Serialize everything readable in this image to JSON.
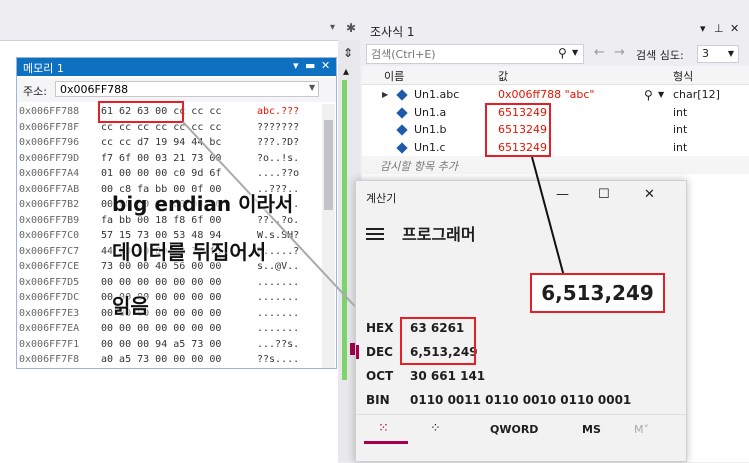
{
  "memory": {
    "title": "메모리 1",
    "address_label": "주소:",
    "address_value": "0x006FF788",
    "rows": [
      {
        "addr": "0x006FF788",
        "hex": "61 62 63 00 cc cc cc",
        "chars": "abc.???"
      },
      {
        "addr": "0x006FF78F",
        "hex": "cc cc cc cc cc cc cc",
        "chars": "???????"
      },
      {
        "addr": "0x006FF796",
        "hex": "cc cc d7 19 94 44 bc",
        "chars": "???.?D?"
      },
      {
        "addr": "0x006FF79D",
        "hex": "f7 6f 00 03 21 73 00",
        "chars": "?o..!s."
      },
      {
        "addr": "0x006FF7A4",
        "hex": "01 00 00 00 c0 9d 6f",
        "chars": "....??o"
      },
      {
        "addr": "0x006FF7AB",
        "hex": "00 c8 fa bb 00 0f 00",
        "chars": "..???.."
      },
      {
        "addr": "0x006FF7B2",
        "hex": "00 00 00 00 00 00 00",
        "chars": "......."
      },
      {
        "addr": "0x006FF7B9",
        "hex": "fa bb 00 18 f8 6f 00",
        "chars": "??..?o."
      },
      {
        "addr": "0x006FF7C0",
        "hex": "57 15 73 00 53 48 94",
        "chars": "W.s.SH?"
      },
      {
        "addr": "0x006FF7C7",
        "hex": "44 00 00 00 00 10 fa",
        "chars": "D.....?"
      },
      {
        "addr": "0x006FF7CE",
        "hex": "73 00 00 40 56 00 00",
        "chars": "s..@V.."
      },
      {
        "addr": "0x006FF7D5",
        "hex": "00 00 00 00 00 00 00",
        "chars": "......."
      },
      {
        "addr": "0x006FF7DC",
        "hex": "00 00 00 00 00 00 00",
        "chars": "......."
      },
      {
        "addr": "0x006FF7E3",
        "hex": "00 00 00 00 00 00 00",
        "chars": "......."
      },
      {
        "addr": "0x006FF7EA",
        "hex": "00 00 00 00 00 00 00",
        "chars": "......."
      },
      {
        "addr": "0x006FF7F1",
        "hex": "00 00 00 94 a5 73 00",
        "chars": "...??s."
      },
      {
        "addr": "0x006FF7F8",
        "hex": "a0 a5 73 00 00 00 00",
        "chars": "??s...."
      }
    ]
  },
  "watch": {
    "title": "조사식 1",
    "search_placeholder": "검색(Ctrl+E)",
    "search_depth_label": "검색 심도:",
    "search_depth_value": "3",
    "columns": {
      "name": "이름",
      "value": "값",
      "type": "형식"
    },
    "rows": [
      {
        "name": "Un1.abc",
        "value": "0x006ff788 \"abc\"",
        "type": "char[12]"
      },
      {
        "name": "Un1.a",
        "value": "6513249",
        "type": "int"
      },
      {
        "name": "Un1.b",
        "value": "6513249",
        "type": "int"
      },
      {
        "name": "Un1.c",
        "value": "6513249",
        "type": "int"
      }
    ],
    "add_item_label": "감시할 항목 추가"
  },
  "calculator": {
    "title": "계산기",
    "mode": "프로그래머",
    "hex_label": "HEX",
    "hex_value": "63 6261",
    "dec_label": "DEC",
    "dec_value": "6,513,249",
    "oct_label": "OCT",
    "oct_value": "30 661 141",
    "bin_label": "BIN",
    "bin_value": "0110 0011 0110 0010 0110 0001",
    "tabs": {
      "word_size": "QWORD",
      "memory_store": "MS",
      "memory_more": "M˅"
    }
  },
  "annotations": {
    "big_result": "6,513,249",
    "note_line1": "big endian 이라서",
    "note_line2": "데이터를 뒤집어서",
    "note_line3": "읽음"
  },
  "colors": {
    "accent": "#0e70c0",
    "highlight": "#e61e25",
    "value_red": "#e51400",
    "calc_accent": "#a4004d"
  }
}
